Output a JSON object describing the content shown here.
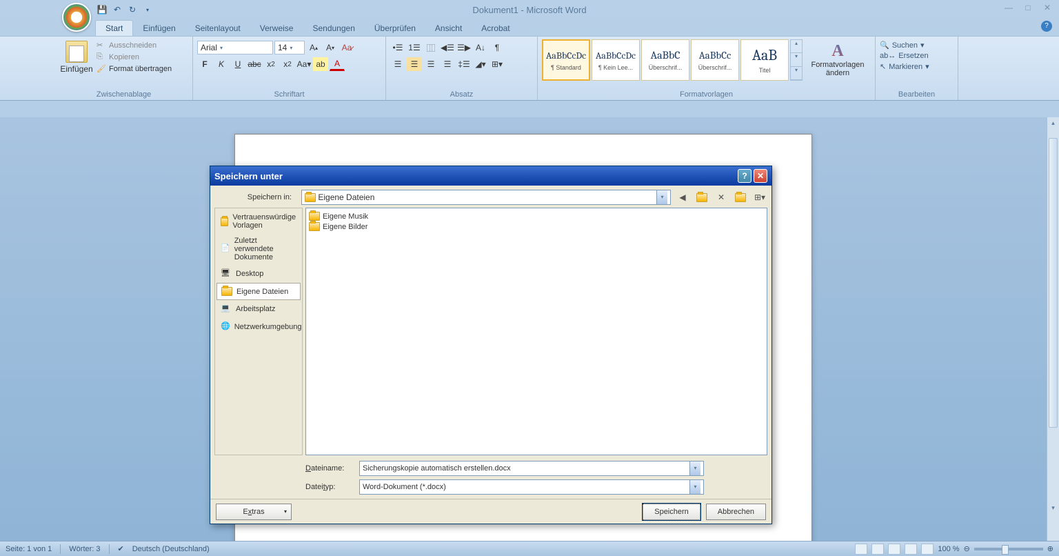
{
  "title": "Dokument1 - Microsoft Word",
  "tabs": [
    "Start",
    "Einfügen",
    "Seitenlayout",
    "Verweise",
    "Sendungen",
    "Überprüfen",
    "Ansicht",
    "Acrobat"
  ],
  "clipboard": {
    "paste": "Einfügen",
    "cut": "Ausschneiden",
    "copy": "Kopieren",
    "format": "Format übertragen",
    "group": "Zwischenablage"
  },
  "font": {
    "name": "Arial",
    "size": "14",
    "group": "Schriftart"
  },
  "paragraph": {
    "group": "Absatz"
  },
  "styles": {
    "items": [
      {
        "prev": "AaBbCcDc",
        "name": "¶ Standard"
      },
      {
        "prev": "AaBbCcDc",
        "name": "¶ Kein Lee..."
      },
      {
        "prev": "AaBbC",
        "name": "Überschrif..."
      },
      {
        "prev": "AaBbCc",
        "name": "Überschrif..."
      },
      {
        "prev": "AaB",
        "name": "Titel"
      }
    ],
    "change": "Formatvorlagen ändern",
    "group": "Formatvorlagen"
  },
  "editing": {
    "find": "Suchen",
    "replace": "Ersetzen",
    "select": "Markieren",
    "group": "Bearbeiten"
  },
  "status": {
    "page": "Seite: 1 von 1",
    "words": "Wörter: 3",
    "lang": "Deutsch (Deutschland)",
    "zoom": "100 %"
  },
  "dialog": {
    "title": "Speichern unter",
    "savein_label": "Speichern in:",
    "savein_value": "Eigene Dateien",
    "places": [
      "Vertrauenswürdige Vorlagen",
      "Zuletzt verwendete Dokumente",
      "Desktop",
      "Eigene Dateien",
      "Arbeitsplatz",
      "Netzwerkumgebung"
    ],
    "files": [
      "Eigene Musik",
      "Eigene Bilder"
    ],
    "filename_label": "Dateiname:",
    "filename_value": "Sicherungskopie automatisch erstellen.docx",
    "filetype_label": "Dateityp:",
    "filetype_value": "Word-Dokument (*.docx)",
    "extras": "Extras",
    "save": "Speichern",
    "cancel": "Abbrechen"
  }
}
